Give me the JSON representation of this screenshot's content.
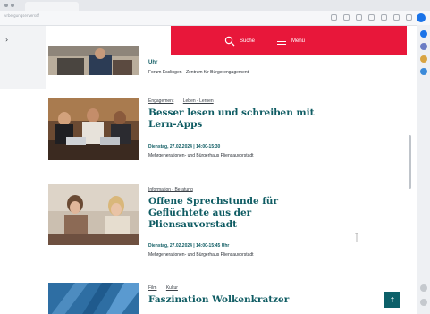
{
  "browser": {
    "url": "vrbeigungserversdf",
    "colors": {
      "profile": "#1a73e8"
    }
  },
  "header": {
    "search_label": "Suche",
    "menu_label": "Menü",
    "color": "#e8173a"
  },
  "articles": [
    {
      "time_fragment": "Uhr",
      "place": "Forum Esslingen - Zentrum für Bürgerengagement"
    },
    {
      "tags": [
        "Engagement",
        "Leben - Lernen"
      ],
      "title": "Besser lesen und schreiben mit Lern-Apps",
      "date": "Dienstag, 27.02.2024 | 14:00-15:30",
      "place": "Mehrgenerationen- und Bürgerhaus Pliensauvorstadt"
    },
    {
      "tags": [
        "Information - Beratung"
      ],
      "title": "Offene Sprechstunde für Geflüchtete aus der Pliensauvorstadt",
      "date": "Dienstag, 27.02.2024 | 14:00-15:45 Uhr",
      "place": "Mehrgenerationen- und Bürgerhaus Pliensauvorstadt"
    },
    {
      "tags": [
        "Film",
        "Kultur"
      ],
      "title": "Faszination Wolkenkratzer"
    }
  ],
  "back_to_top_icon": "arrow-up-icon",
  "colors": {
    "title": "#0f5c63",
    "back_to_top": "#0c6069"
  }
}
